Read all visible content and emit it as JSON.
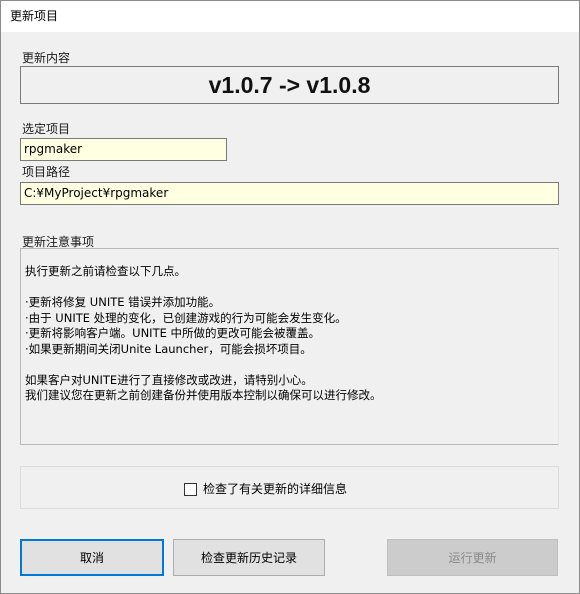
{
  "window": {
    "title": "更新项目"
  },
  "update_content": {
    "label": "更新内容",
    "version_text": "v1.0.7 -> v1.0.8"
  },
  "selected_project": {
    "label": "选定项目",
    "value": "rpgmaker"
  },
  "project_path": {
    "label": "项目路径",
    "value": "C:¥MyProject¥rpgmaker"
  },
  "notes": {
    "label": "更新注意事项",
    "lines": [
      "执行更新之前请检查以下几点。",
      "",
      "·更新将修复 UNITE 错误并添加功能。",
      "·由于 UNITE 处理的变化，已创建游戏的行为可能会发生变化。",
      "·更新将影响客户端。UNITE 中所做的更改可能会被覆盖。",
      "·如果更新期间关闭Unite Launcher，可能会损坏项目。",
      "",
      "如果客户对UNITE进行了直接修改或改进，请特别小心。",
      "我们建议您在更新之前创建备份并使用版本控制以确保可以进行修改。"
    ]
  },
  "confirm": {
    "checked": false,
    "label": "检查了有关更新的详细信息"
  },
  "buttons": {
    "cancel": "取消",
    "history": "检查更新历史记录",
    "run_update": "运行更新"
  },
  "colors": {
    "field_background": "#ffffe1",
    "focus_border": "#0078d7",
    "window_background": "#f0f0f0"
  }
}
